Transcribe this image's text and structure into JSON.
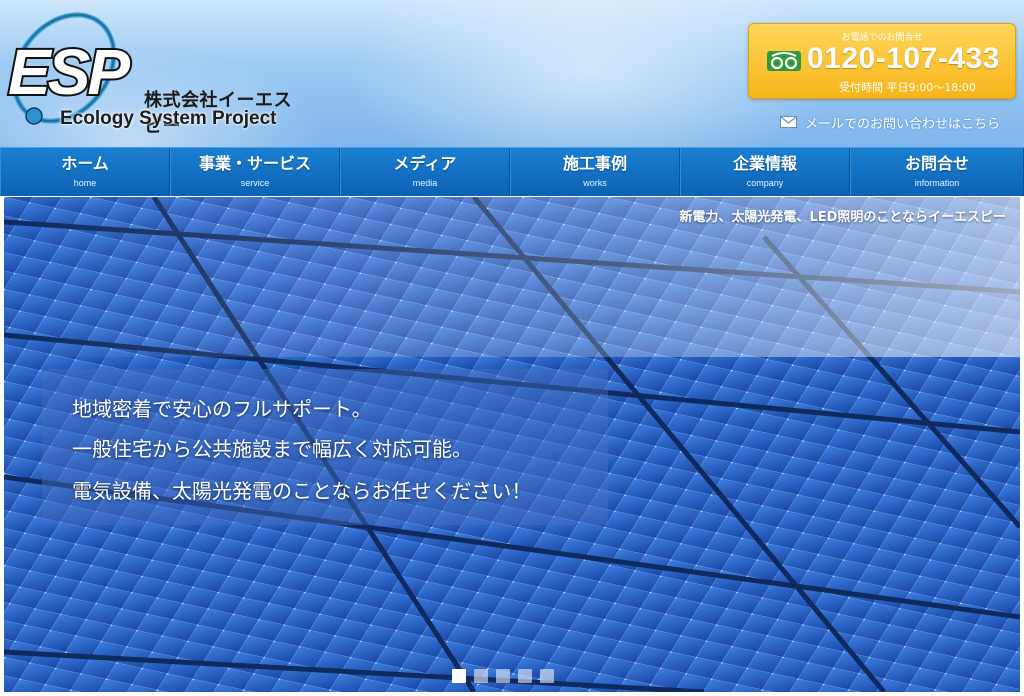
{
  "header": {
    "logo_letters": "ESP",
    "company_name": "株式会社イーエスピー",
    "tagline": "Ecology System Project",
    "tel": {
      "caption": "お電話でのお問合せ",
      "icon": "free-dial-icon",
      "number": "0120-107-433",
      "hours": "受付時間 平日9:00～18:00"
    },
    "mail": {
      "icon": "mail-icon",
      "label": "メールでのお問い合わせはこちら"
    }
  },
  "nav": {
    "items": [
      {
        "label": "ホーム",
        "sub": "home"
      },
      {
        "label": "事業・サービス",
        "sub": "service"
      },
      {
        "label": "メディア",
        "sub": "media"
      },
      {
        "label": "施工事例",
        "sub": "works"
      },
      {
        "label": "企業情報",
        "sub": "company"
      },
      {
        "label": "お問合せ",
        "sub": "information"
      }
    ]
  },
  "hero": {
    "tag": "新電力、太陽光発電、LED照明のことならイーエスピー",
    "lines": [
      "地域密着で安心のフルサポート。",
      "一般住宅から公共施設まで幅広く対応可能。",
      "電気設備、太陽光発電のことならお任せください！"
    ],
    "slides": {
      "count": 5,
      "active": 1
    }
  },
  "colors": {
    "nav_blue": "#0c62b4",
    "tel_orange": "#f7b51a",
    "panel_blue": "#1d4fb0"
  }
}
